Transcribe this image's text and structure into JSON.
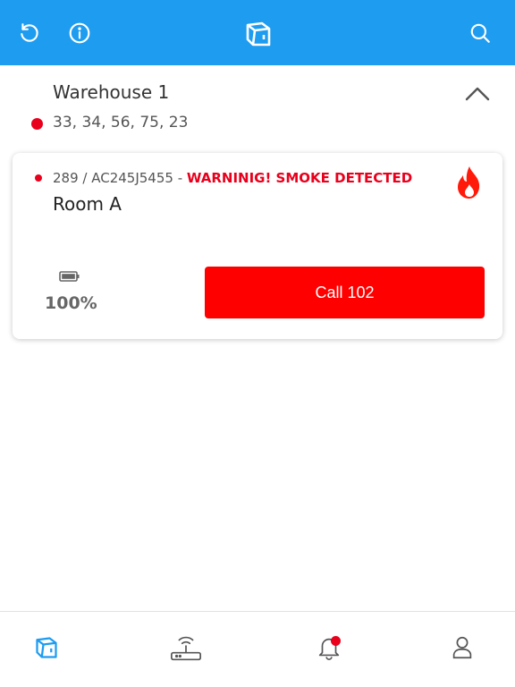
{
  "header": {
    "icons": [
      "refresh-icon",
      "info-icon",
      "app-logo-icon",
      "search-icon"
    ]
  },
  "group": {
    "title": "Warehouse 1",
    "ids": "33, 34, 56, 75, 23",
    "status_color": "#e8001c",
    "expanded": true
  },
  "device": {
    "meta": "289 / AC245J5455 - ",
    "warning": "WARNINIG! SMOKE DETECTED",
    "room": "Room A",
    "battery": "100%",
    "alert_icon": "fire-icon",
    "call_label": "Call 102"
  },
  "bottom_nav": {
    "items": [
      "devices-icon",
      "router-icon",
      "bell-icon",
      "profile-icon"
    ],
    "active": "devices-icon"
  },
  "colors": {
    "header_bg": "#1e9cf0",
    "alert_red": "#fe0000",
    "active_nav": "#1e9cf0"
  }
}
